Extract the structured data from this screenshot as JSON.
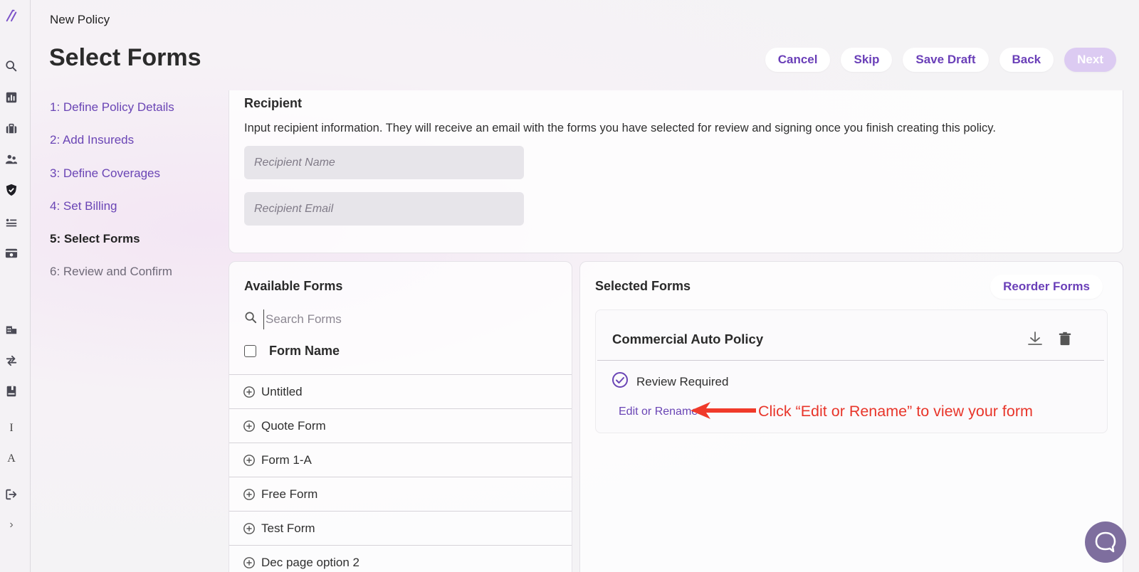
{
  "header": {
    "breadcrumb": "New Policy",
    "title": "Select Forms",
    "actions": {
      "cancel": "Cancel",
      "skip": "Skip",
      "save_draft": "Save Draft",
      "back": "Back",
      "next": "Next"
    }
  },
  "rail": {
    "logo": "logo-icon",
    "icons": [
      "search-icon",
      "chart-icon",
      "briefcase-icon",
      "users-icon",
      "shield-icon",
      "list-icon",
      "card-icon",
      "building-icon",
      "transfer-icon",
      "book-icon",
      "text-cursor-icon",
      "font-icon",
      "logout-icon",
      "chevron-right-icon"
    ],
    "text_icon_1": "I",
    "text_icon_2": "A",
    "expand": "›"
  },
  "steps": [
    {
      "label": "1: Define Policy Details",
      "state": "link"
    },
    {
      "label": "2: Add Insureds",
      "state": "link"
    },
    {
      "label": "3: Define Coverages",
      "state": "link"
    },
    {
      "label": "4: Set Billing",
      "state": "link"
    },
    {
      "label": "5: Select Forms",
      "state": "active"
    },
    {
      "label": "6: Review and Confirm",
      "state": "muted"
    }
  ],
  "recipient": {
    "title": "Recipient",
    "description": "Input recipient information. They will receive an email with the forms you have selected for review and signing once you finish creating this policy.",
    "name_placeholder": "Recipient Name",
    "email_placeholder": "Recipient Email"
  },
  "available_forms": {
    "title": "Available Forms",
    "search_placeholder": "Search Forms",
    "column_header": "Form Name",
    "items": [
      "Untitled",
      "Quote Form",
      "Form 1-A",
      "Free Form",
      "Test Form",
      "Dec page option 2"
    ]
  },
  "selected_forms": {
    "title": "Selected Forms",
    "reorder_label": "Reorder Forms",
    "cards": [
      {
        "title": "Commercial Auto Policy",
        "status": "Review Required",
        "edit_label": "Edit or Rename"
      }
    ]
  },
  "annotation": {
    "text": "Click “Edit or Rename” to view your form",
    "color": "#e8352a"
  },
  "colors": {
    "accent": "#6a45b5",
    "next_disabled_bg": "#dccbf2"
  }
}
